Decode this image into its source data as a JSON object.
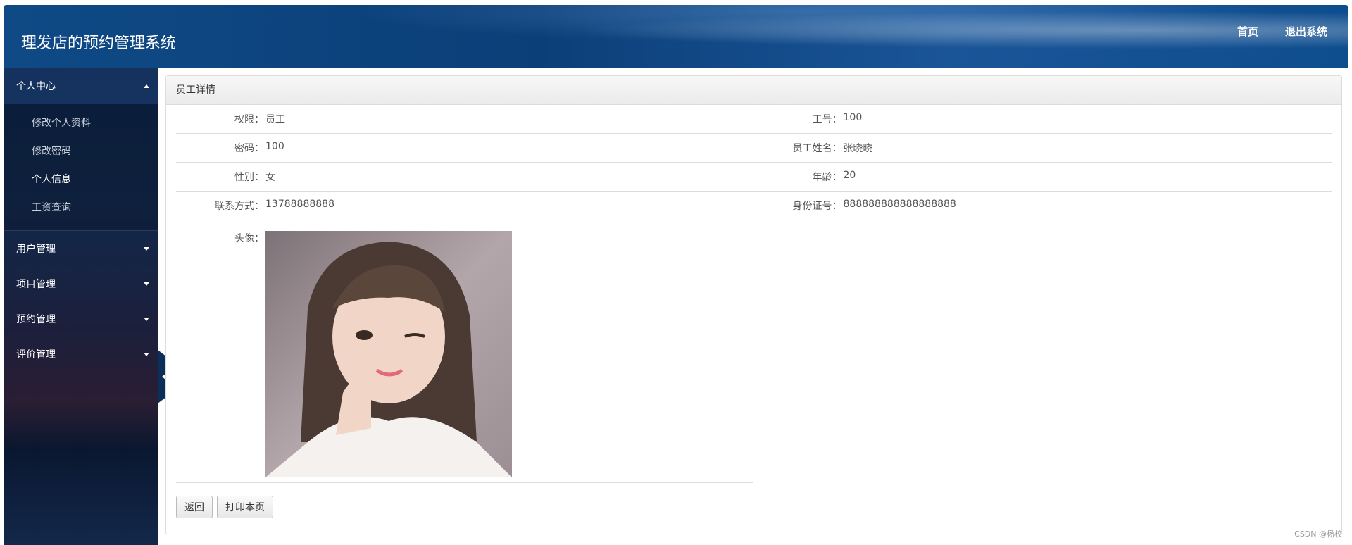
{
  "header": {
    "title": "理发店的预约管理系统",
    "nav": [
      {
        "label": "首页"
      },
      {
        "label": "退出系统"
      }
    ]
  },
  "sidebar": {
    "groups": [
      {
        "label": "个人中心",
        "expanded": true,
        "items": [
          {
            "label": "修改个人资料",
            "active": false
          },
          {
            "label": "修改密码",
            "active": false
          },
          {
            "label": "个人信息",
            "active": true
          },
          {
            "label": "工资查询",
            "active": false
          }
        ]
      },
      {
        "label": "用户管理",
        "expanded": false
      },
      {
        "label": "项目管理",
        "expanded": false
      },
      {
        "label": "预约管理",
        "expanded": false
      },
      {
        "label": "评价管理",
        "expanded": false
      }
    ]
  },
  "panel": {
    "title": "员工详情",
    "rows": [
      [
        {
          "label": "权限：",
          "value": "员工"
        },
        {
          "label": "工号：",
          "value": "100"
        }
      ],
      [
        {
          "label": "密码：",
          "value": "100"
        },
        {
          "label": "员工姓名：",
          "value": "张晓晓"
        }
      ],
      [
        {
          "label": "性别：",
          "value": "女"
        },
        {
          "label": "年龄：",
          "value": "20"
        }
      ],
      [
        {
          "label": "联系方式：",
          "value": "13788888888"
        },
        {
          "label": "身份证号：",
          "value": "888888888888888888"
        }
      ]
    ],
    "avatar_label": "头像：",
    "buttons": {
      "back": "返回",
      "print": "打印本页"
    }
  },
  "watermark": "CSDN @杨校",
  "colors": {
    "header_bg": "#0f4a86",
    "sidebar_bg": "#12284a",
    "panel_head_bg": "#efefef"
  },
  "icons": {
    "expanded_caret": "caret-up-icon",
    "collapsed_caret": "caret-down-icon",
    "collapse_toggle": "chevron-left-icon"
  }
}
